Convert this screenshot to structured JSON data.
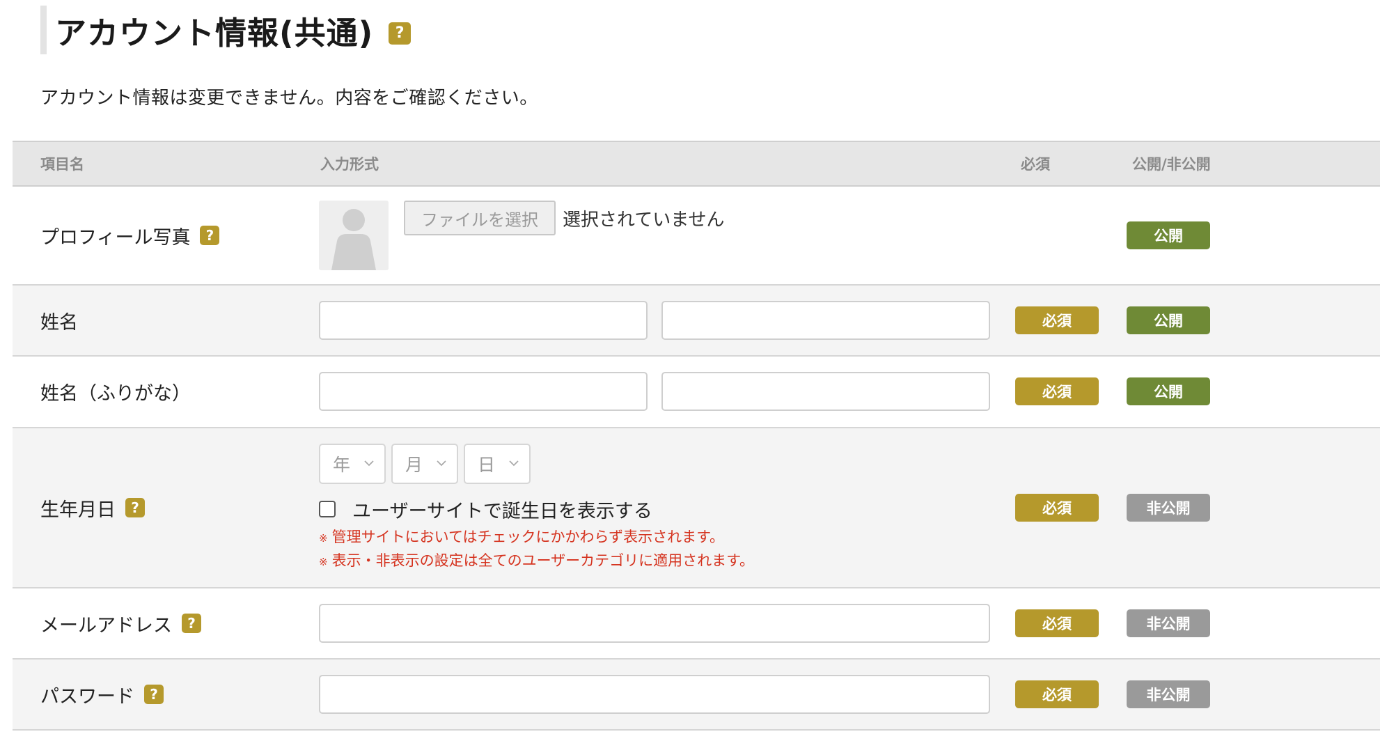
{
  "heading": {
    "title": "アカウント情報(共通)",
    "help": "?"
  },
  "intro": "アカウント情報は変更できません。内容をご確認ください。",
  "table": {
    "headers": {
      "item": "項目名",
      "input": "入力形式",
      "required": "必須",
      "visibility": "公開/非公開"
    },
    "help": "?",
    "required_label": "必須",
    "public_label": "公開",
    "private_label": "非公開",
    "rows": {
      "profile": {
        "label": "プロフィール写真",
        "file_button": "ファイルを選択",
        "file_status": "選択されていません"
      },
      "name": {
        "label": "姓名"
      },
      "kana": {
        "label": "姓名（ふりがな）"
      },
      "birthday": {
        "label": "生年月日",
        "year": "年",
        "month": "月",
        "day": "日",
        "checkbox_label": "ユーザーサイトで誕生日を表示する",
        "note_mark": "※",
        "note1": "管理サイトにおいてはチェックにかかわらず表示されます。",
        "note2": "表示・非表示の設定は全てのユーザーカテゴリに適用されます。"
      },
      "email": {
        "label": "メールアドレス"
      },
      "password": {
        "label": "パスワード"
      }
    }
  },
  "colors": {
    "required": "#b5992c",
    "public": "#6f8a36",
    "private": "#9a9a9a",
    "note": "#d5331f"
  }
}
